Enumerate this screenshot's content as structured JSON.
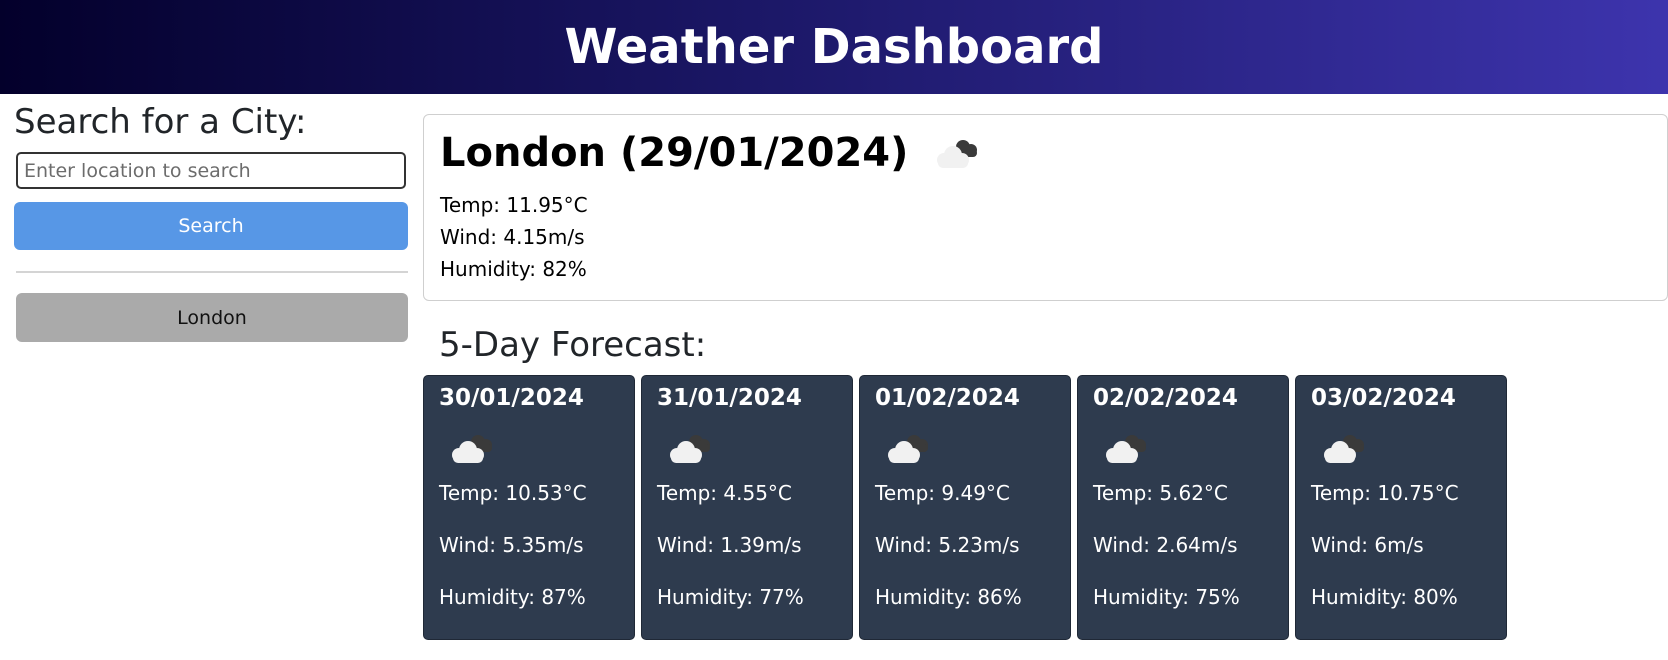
{
  "header": {
    "title": "Weather Dashboard",
    "gradient_colors": [
      "#03002b",
      "#1b1766",
      "#3d34ad"
    ]
  },
  "sidebar": {
    "heading": "Search for a City:",
    "search_placeholder": "Enter location to search",
    "search_value": "",
    "search_button_label": "Search",
    "search_button_color": "#5797e6",
    "history": [
      {
        "label": "London"
      }
    ]
  },
  "current": {
    "title": "London (29/01/2024)",
    "icon": "broken-clouds-icon",
    "temp": "Temp: 11.95°C",
    "wind": "Wind: 4.15m/s",
    "humidity": "Humidity: 82%"
  },
  "forecast": {
    "heading": "5-Day Forecast:",
    "card_color": "#2e3b4e",
    "days": [
      {
        "date": "30/01/2024",
        "icon": "broken-clouds-icon",
        "temp": "Temp: 10.53°C",
        "wind": "Wind: 5.35m/s",
        "humidity": "Humidity: 87%"
      },
      {
        "date": "31/01/2024",
        "icon": "broken-clouds-icon",
        "temp": "Temp: 4.55°C",
        "wind": "Wind: 1.39m/s",
        "humidity": "Humidity: 77%"
      },
      {
        "date": "01/02/2024",
        "icon": "broken-clouds-icon",
        "temp": "Temp: 9.49°C",
        "wind": "Wind: 5.23m/s",
        "humidity": "Humidity: 86%"
      },
      {
        "date": "02/02/2024",
        "icon": "broken-clouds-icon",
        "temp": "Temp: 5.62°C",
        "wind": "Wind: 2.64m/s",
        "humidity": "Humidity: 75%"
      },
      {
        "date": "03/02/2024",
        "icon": "broken-clouds-icon",
        "temp": "Temp: 10.75°C",
        "wind": "Wind: 6m/s",
        "humidity": "Humidity: 80%"
      }
    ]
  }
}
